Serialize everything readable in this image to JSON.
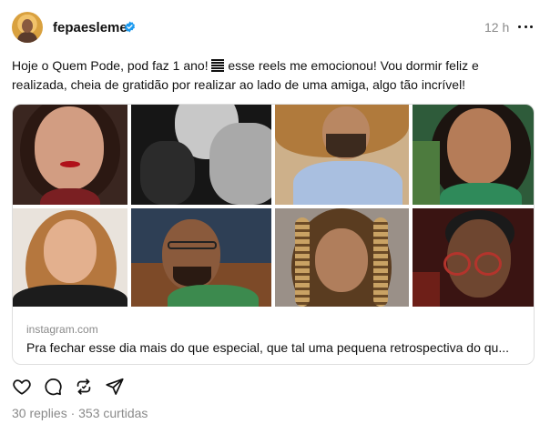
{
  "post": {
    "username": "fepaesleme",
    "timestamp": "12 h",
    "caption_line1_a": "Hoje o Quem Pode, pod faz 1 ano! ",
    "caption_line1_b": " esse reels me emocionou! Vou dormir feliz e",
    "caption_line2": "realizada, cheia de gratidão por realizar ao lado de uma amiga, algo tão incrível!",
    "icons": {
      "verified": "verified-badge-icon",
      "more": "more-options-icon",
      "emoji": "emoji-icon",
      "like": "heart-icon",
      "reply": "comment-icon",
      "repost": "repost-icon",
      "share": "send-icon"
    },
    "colors": {
      "verified": "#1d9bf0",
      "secondary_text": "#8a8a8a",
      "text": "#111111"
    }
  },
  "link_card": {
    "domain": "instagram.com",
    "title": "Pra fechar esse dia mais do que especial, que tal uma pequena retrospectiva do qu..."
  },
  "stats": {
    "text": "30 replies · 353 curtidas"
  }
}
